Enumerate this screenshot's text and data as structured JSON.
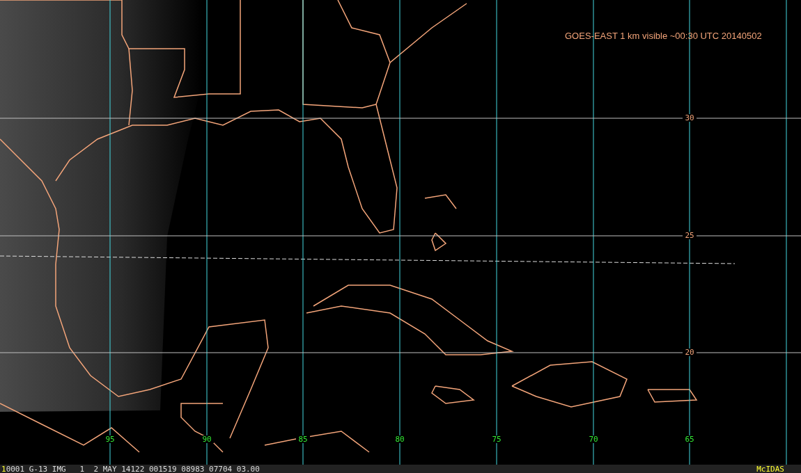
{
  "title": "GOES-EAST 1 km visible ~00:30 UTC 20140502",
  "lon_labels": [
    "95",
    "90",
    "85",
    "80",
    "75",
    "70",
    "65"
  ],
  "lat_labels": [
    "30",
    "25",
    "20"
  ],
  "status_bar": {
    "frame": "1",
    "info": "0001 G-13 IMG   1  2 MAY 14122 001519 08983 07704 03.00",
    "brand": "McIDAS"
  }
}
